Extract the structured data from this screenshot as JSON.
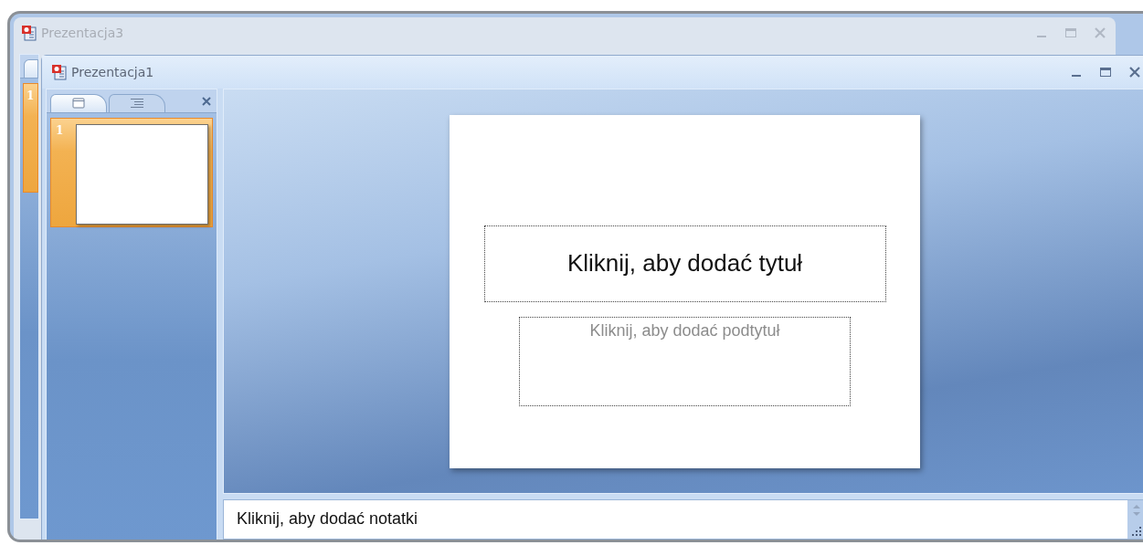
{
  "windows": [
    {
      "title": "Prezentacja3",
      "active": false,
      "slides": [
        {
          "number": "1"
        }
      ]
    },
    {
      "title": "Prezentacja1",
      "active": true,
      "pane_tabs": [
        {
          "kind": "slides",
          "selected": true
        },
        {
          "kind": "outline",
          "selected": false
        }
      ],
      "slides": [
        {
          "number": "1",
          "selected": true
        }
      ],
      "slide": {
        "title_placeholder": "Kliknij, aby dodać tytuł",
        "subtitle_placeholder": "Kliknij, aby dodać podtytuł"
      },
      "notes": {
        "placeholder": "Kliknij, aby dodać notatki"
      }
    }
  ]
}
